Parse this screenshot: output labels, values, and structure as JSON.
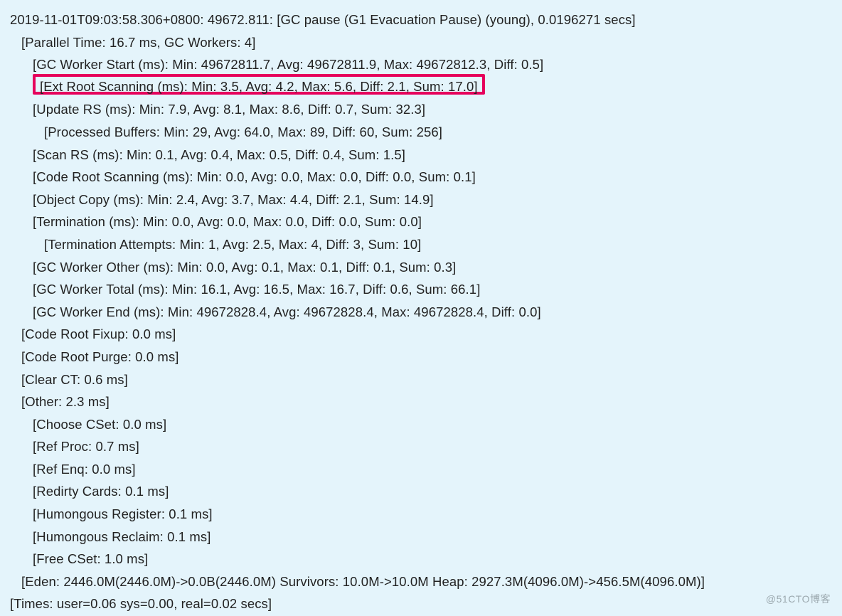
{
  "lines": {
    "l0": "2019-11-01T09:03:58.306+0800: 49672.811: [GC pause (G1 Evacuation Pause) (young), 0.0196271 secs]",
    "l1": "[Parallel Time: 16.7 ms, GC Workers: 4]",
    "l2": "[GC Worker Start (ms): Min: 49672811.7, Avg: 49672811.9, Max: 49672812.3, Diff: 0.5]",
    "l3": "[Ext Root Scanning (ms): Min: 3.5, Avg: 4.2, Max: 5.6, Diff: 2.1, Sum: 17.0]",
    "l4": "[Update RS (ms): Min: 7.9, Avg: 8.1, Max: 8.6, Diff: 0.7, Sum: 32.3]",
    "l5": "[Processed Buffers: Min: 29, Avg: 64.0, Max: 89, Diff: 60, Sum: 256]",
    "l6": "[Scan RS (ms): Min: 0.1, Avg: 0.4, Max: 0.5, Diff: 0.4, Sum: 1.5]",
    "l7": "[Code Root Scanning (ms): Min: 0.0, Avg: 0.0, Max: 0.0, Diff: 0.0, Sum: 0.1]",
    "l8": "[Object Copy (ms): Min: 2.4, Avg: 3.7, Max: 4.4, Diff: 2.1, Sum: 14.9]",
    "l9": "[Termination (ms): Min: 0.0, Avg: 0.0, Max: 0.0, Diff: 0.0, Sum: 0.0]",
    "l10": "[Termination Attempts: Min: 1, Avg: 2.5, Max: 4, Diff: 3, Sum: 10]",
    "l11": "[GC Worker Other (ms): Min: 0.0, Avg: 0.1, Max: 0.1, Diff: 0.1, Sum: 0.3]",
    "l12": "[GC Worker Total (ms): Min: 16.1, Avg: 16.5, Max: 16.7, Diff: 0.6, Sum: 66.1]",
    "l13": "[GC Worker End (ms): Min: 49672828.4, Avg: 49672828.4, Max: 49672828.4, Diff: 0.0]",
    "l14": "[Code Root Fixup: 0.0 ms]",
    "l15": "[Code Root Purge: 0.0 ms]",
    "l16": "[Clear CT: 0.6 ms]",
    "l17": "[Other: 2.3 ms]",
    "l18": "[Choose CSet: 0.0 ms]",
    "l19": "[Ref Proc: 0.7 ms]",
    "l20": "[Ref Enq: 0.0 ms]",
    "l21": "[Redirty Cards: 0.1 ms]",
    "l22": "[Humongous Register: 0.1 ms]",
    "l23": "[Humongous Reclaim: 0.1 ms]",
    "l24": "[Free CSet: 1.0 ms]",
    "l25": "[Eden: 2446.0M(2446.0M)->0.0B(2446.0M) Survivors: 10.0M->10.0M Heap: 2927.3M(4096.0M)->456.5M(4096.0M)]",
    "l26": "[Times: user=0.06 sys=0.00, real=0.02 secs]"
  },
  "watermark": "@51CTO博客"
}
